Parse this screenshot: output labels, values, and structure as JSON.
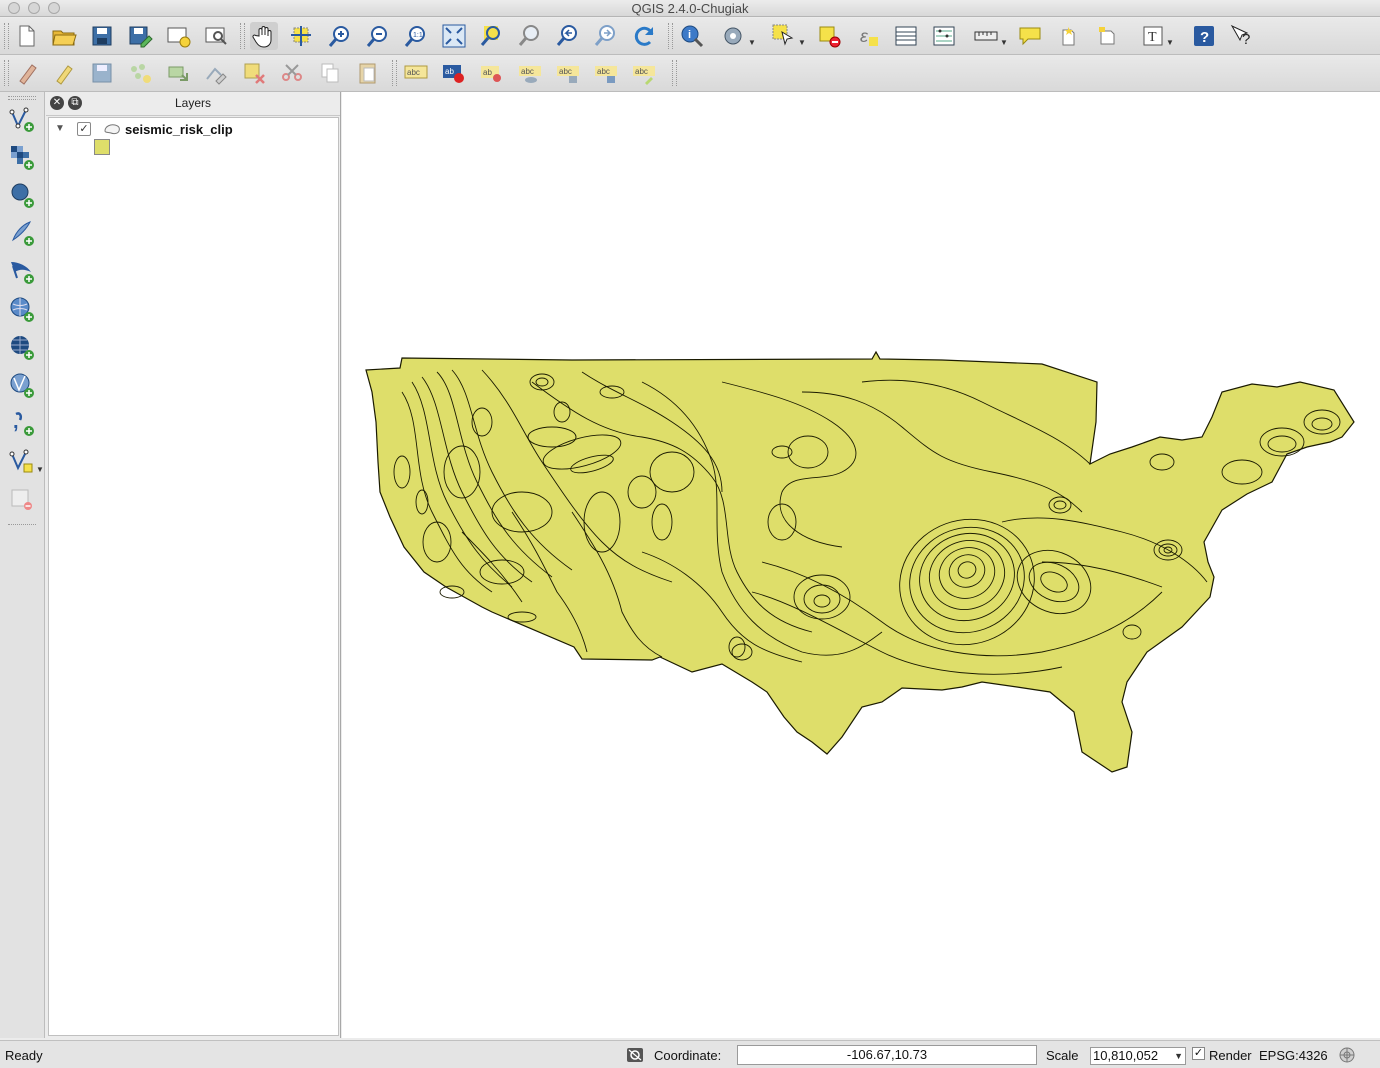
{
  "window": {
    "title": "QGIS 2.4.0-Chugiak"
  },
  "toolbar_main": {
    "buttons": [
      "new-project-icon",
      "open-project-icon",
      "save-project-icon",
      "save-as-icon",
      "new-print-composer-icon",
      "composer-manager-icon",
      "pan-icon",
      "pan-to-selection-icon",
      "zoom-in-icon",
      "zoom-out-icon",
      "zoom-actual-size-icon",
      "zoom-full-icon",
      "zoom-to-selection-icon",
      "zoom-to-layer-icon",
      "zoom-last-icon",
      "zoom-next-icon",
      "refresh-icon",
      "identify-icon",
      "run-action-icon",
      "select-features-icon",
      "deselect-icon",
      "field-calculator-icon",
      "attribute-table-icon",
      "statistics-icon",
      "measure-icon",
      "map-tips-icon",
      "new-bookmark-icon",
      "show-bookmarks-icon",
      "text-annotation-icon",
      "help-icon",
      "whats-this-icon"
    ]
  },
  "toolbar_digitize": {
    "buttons": [
      "current-edits-icon",
      "toggle-editing-icon",
      "save-edits-icon",
      "add-feature-icon",
      "move-feature-icon",
      "node-tool-icon",
      "delete-selected-icon",
      "cut-features-icon",
      "copy-features-icon",
      "paste-features-icon",
      "layer-labeling-icon",
      "label-pin-icon",
      "label-highlight-icon",
      "label-show-hide-icon",
      "label-move-icon",
      "label-rotate-icon",
      "label-change-icon"
    ]
  },
  "left_toolbar": {
    "buttons": [
      "add-vector-layer-icon",
      "add-raster-layer-icon",
      "add-postgis-layer-icon",
      "add-spatialite-layer-icon",
      "add-mssql-layer-icon",
      "add-wms-layer-icon",
      "add-wcs-layer-icon",
      "add-wfs-layer-icon",
      "add-delimited-text-layer-icon",
      "new-shapefile-layer-icon",
      "remove-layer-icon"
    ]
  },
  "layers_panel": {
    "title": "Layers",
    "layers": [
      {
        "name": "seismic_risk_clip",
        "visible": true,
        "fill_color": "#dede6a"
      }
    ]
  },
  "map": {
    "layer": "seismic_risk_clip",
    "fill_color": "#dede6a",
    "stroke_color": "#1a1a00",
    "background": "#ffffff"
  },
  "status": {
    "message": "Ready",
    "coordinate_label": "Coordinate:",
    "coordinate_value": "-106.67,10.73",
    "scale_label": "Scale",
    "scale_value": "10,810,052",
    "render_label": "Render",
    "render_checked": true,
    "crs": "EPSG:4326"
  }
}
